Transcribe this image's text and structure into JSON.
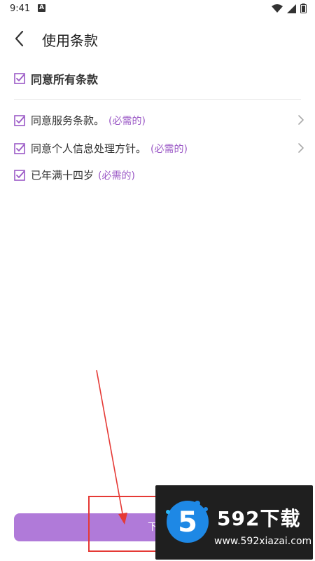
{
  "status": {
    "time": "9:41",
    "notif": "A"
  },
  "header": {
    "title": "使用条款"
  },
  "terms": {
    "all_label": "同意所有条款",
    "items": [
      {
        "label": "同意服务条款。",
        "required": "(必需的)"
      },
      {
        "label": "同意个人信息处理方针。",
        "required": "(必需的)"
      },
      {
        "label": "已年满十四岁",
        "required": "(必需的)"
      }
    ]
  },
  "footer": {
    "next_label": "下一"
  },
  "watermark": {
    "brand": "592下载",
    "url": "www.592xiazai.com",
    "logo_digit": "5"
  },
  "colors": {
    "accent": "#9b59c6",
    "button": "#b07ad9",
    "annotation": "#e53935"
  }
}
